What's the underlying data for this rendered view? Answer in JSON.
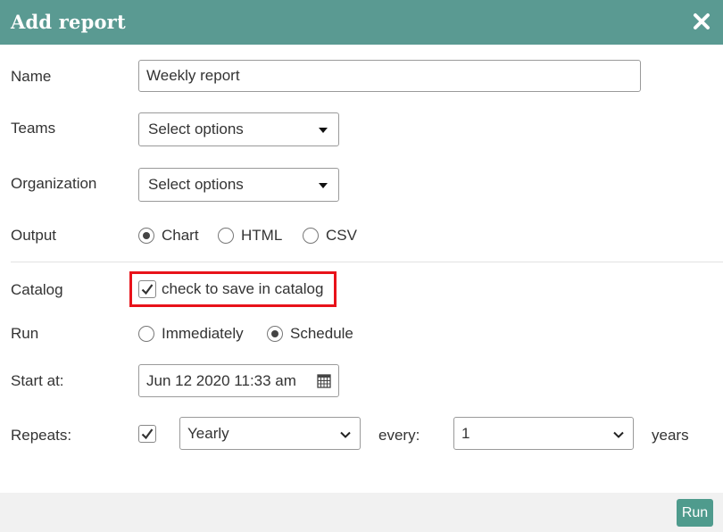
{
  "dialog": {
    "title": "Add report",
    "close_icon": "close-icon"
  },
  "form": {
    "name": {
      "label": "Name",
      "value": "Weekly report"
    },
    "teams": {
      "label": "Teams",
      "value": "Select options"
    },
    "organization": {
      "label": "Organization",
      "value": "Select options"
    },
    "output": {
      "label": "Output",
      "options": [
        {
          "label": "Chart",
          "selected": true
        },
        {
          "label": "HTML",
          "selected": false
        },
        {
          "label": "CSV",
          "selected": false
        }
      ]
    },
    "catalog": {
      "label": "Catalog",
      "checkbox_label": "check to save in catalog",
      "checked": true
    },
    "run": {
      "label": "Run",
      "options": [
        {
          "label": "Immediately",
          "selected": false
        },
        {
          "label": "Schedule",
          "selected": true
        }
      ]
    },
    "start_at": {
      "label": "Start at:",
      "value": "Jun 12 2020 11:33 am"
    },
    "repeats": {
      "label": "Repeats:",
      "checked": true,
      "frequency": "Yearly",
      "every_label": "every:",
      "interval": "1",
      "unit_label": "years"
    }
  },
  "footer": {
    "run_label": "Run"
  },
  "colors": {
    "header": "#5a9a92",
    "run_button": "#4f9b8d",
    "highlight": "#e8121a"
  }
}
